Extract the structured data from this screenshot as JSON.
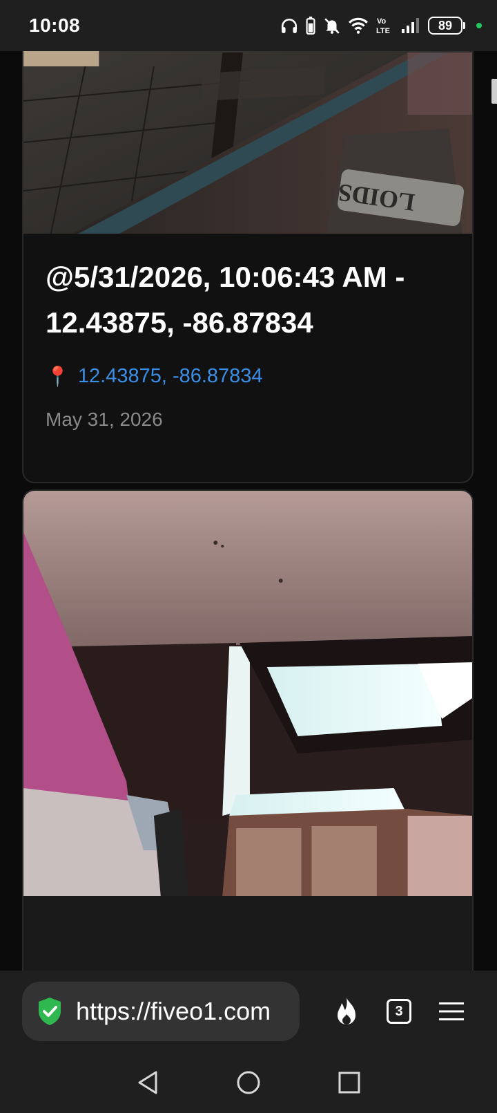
{
  "status_bar": {
    "time": "10:08",
    "battery": "89",
    "icons": [
      "headphones-icon",
      "battery-saver-icon",
      "bell-muted-icon",
      "wifi-icon",
      "volte-icon",
      "signal-icon"
    ]
  },
  "posts": [
    {
      "title": "@5/31/2026, 10:06:43 AM - 12.43875, -86.87834",
      "location_icon": "pin-icon",
      "location": "12.43875, -86.87834",
      "date": "May 31, 2026"
    }
  ],
  "browser": {
    "url": "https://fiveo1.com",
    "tab_count": "3",
    "colors": {
      "secure": "#2fb84f",
      "link": "#3a8ee6"
    }
  },
  "nav": [
    "back-icon",
    "home-icon",
    "recents-icon"
  ]
}
